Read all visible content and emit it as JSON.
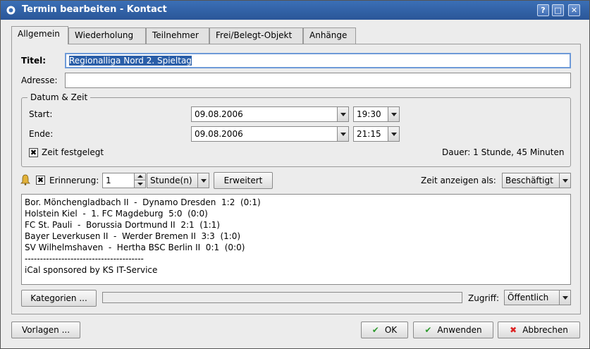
{
  "window": {
    "title": "Termin bearbeiten - Kontact",
    "controls": {
      "help": "?",
      "maximize": "□",
      "close": "✕"
    }
  },
  "tabs": [
    {
      "label": "Allgemein",
      "active": true
    },
    {
      "label": "Wiederholung",
      "active": false
    },
    {
      "label": "Teilnehmer",
      "active": false
    },
    {
      "label": "Frei/Belegt-Objekt",
      "active": false
    },
    {
      "label": "Anhänge",
      "active": false
    }
  ],
  "form": {
    "title_label": "Titel:",
    "title_value": "Regionalliga Nord 2. Spieltag",
    "address_label": "Adresse:",
    "address_value": ""
  },
  "datetime": {
    "group_title": "Datum & Zeit",
    "start_label": "Start:",
    "start_date": "09.08.2006",
    "start_time": "19:30",
    "end_label": "Ende:",
    "end_date": "09.08.2006",
    "end_time": "21:15",
    "fixed_time_label": "Zeit festgelegt",
    "fixed_time_checked": "✖",
    "duration": "Dauer: 1 Stunde, 45 Minuten"
  },
  "reminder": {
    "checked": "✖",
    "label": "Erinnerung:",
    "value": "1",
    "unit": "Stunde(n)",
    "advanced_button": "Erweitert",
    "show_time_as_label": "Zeit anzeigen als:",
    "show_time_as_value": "Beschäftigt"
  },
  "notes": [
    "Bor. Mönchengladbach II  -  Dynamo Dresden  1:2  (0:1)",
    "Holstein Kiel  -  1. FC Magdeburg  5:0  (0:0)",
    "FC St. Pauli  -  Borussia Dortmund II  2:1  (1:1)",
    "Bayer Leverkusen II  -  Werder Bremen II  3:3  (1:0)",
    "SV Wilhelmshaven  -  Hertha BSC Berlin II  0:1  (0:0)",
    "---------------------------------------",
    "iCal sponsored by KS IT-Service"
  ],
  "footer_row": {
    "categories_button": "Kategorien ...",
    "access_label": "Zugriff:",
    "access_value": "Öffentlich"
  },
  "buttons": {
    "templates": "Vorlagen ...",
    "ok": "OK",
    "apply": "Anwenden",
    "cancel": "Abbrechen"
  },
  "colors": {
    "titlebar": "#2a5698",
    "ok_icon": "#2e9a2e",
    "cancel_icon": "#d22"
  }
}
